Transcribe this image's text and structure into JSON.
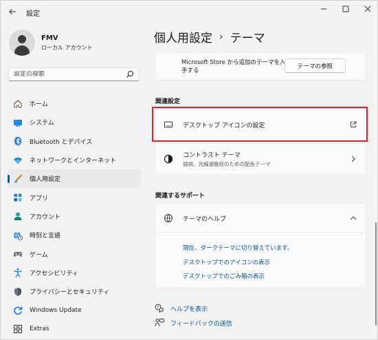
{
  "window": {
    "title": "設定"
  },
  "user": {
    "name": "FMV",
    "account_type": "ローカル アカウント"
  },
  "search": {
    "placeholder": "設定の検索"
  },
  "nav": {
    "items": [
      {
        "label": "ホーム",
        "icon": "home-icon"
      },
      {
        "label": "システム",
        "icon": "system-icon"
      },
      {
        "label": "Bluetooth とデバイス",
        "icon": "bluetooth-icon"
      },
      {
        "label": "ネットワークとインターネット",
        "icon": "network-icon"
      },
      {
        "label": "個人用設定",
        "icon": "personalization-icon",
        "active": true
      },
      {
        "label": "アプリ",
        "icon": "apps-icon"
      },
      {
        "label": "アカウント",
        "icon": "accounts-icon"
      },
      {
        "label": "時刻と言語",
        "icon": "time-language-icon"
      },
      {
        "label": "ゲーム",
        "icon": "gaming-icon"
      },
      {
        "label": "アクセシビリティ",
        "icon": "accessibility-icon"
      },
      {
        "label": "プライバシーとセキュリティ",
        "icon": "privacy-shield-icon"
      },
      {
        "label": "Windows Update",
        "icon": "windows-update-icon"
      },
      {
        "label": "Extras",
        "icon": "extras-icon"
      }
    ]
  },
  "breadcrumb": {
    "parent": "個人用設定",
    "separator": "›",
    "current": "テーマ"
  },
  "store": {
    "text": "Microsoft Store から追加のテーマを入手する",
    "button": "テーマの参照"
  },
  "related": {
    "title": "関連設定",
    "desktop_icons": {
      "label": "デスクトップ アイコンの設定"
    },
    "contrast": {
      "label": "コントラスト テーマ",
      "sub": "弱視、光線過敏症のための配色テーマ"
    }
  },
  "support": {
    "title": "関連するサポート",
    "help": {
      "label": "テーマのヘルプ",
      "links": [
        "現在、ダークテーマに切り替えています。",
        "デスクトップでのアイコンの表示",
        "デスクトップでのごみ箱の表示"
      ]
    }
  },
  "footer": {
    "help": "ヘルプを表示",
    "feedback": "フィードバックの送信"
  },
  "colors": {
    "accent": "#005fb8",
    "highlight": "#d9262f",
    "link": "#0050a0"
  }
}
